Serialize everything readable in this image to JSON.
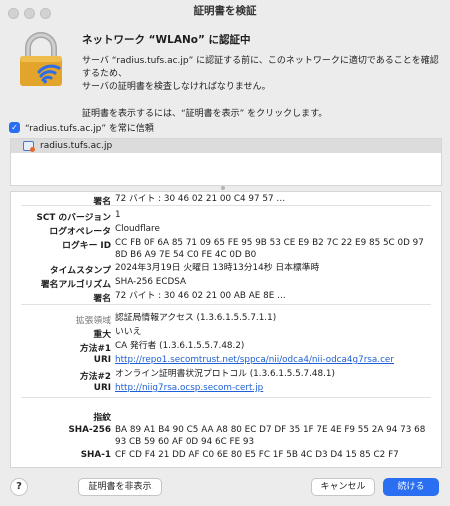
{
  "window": {
    "title": "証明書を検証"
  },
  "header": {
    "title": "ネットワーク “WLANo” に認証中",
    "desc1": "サーバ “radius.tufs.ac.jp” に認証する前に、このネットワークに適切であることを確認するため、",
    "desc2": "サーバの証明書を検査しなければなりません。",
    "note": "証明書を表示するには、“証明書を表示” をクリックします。"
  },
  "trust": {
    "label": "“radius.tufs.ac.jp” を常に信頼",
    "checked": true
  },
  "cert_list": {
    "selected": "radius.tufs.ac.jp"
  },
  "details": {
    "rows": [
      {
        "key": "署名",
        "value": "72 バイト : 30 46 02 21 00 C4 97 57 …"
      },
      {
        "key": "SCT のバージョン",
        "value": "1"
      },
      {
        "key": "ログオペレータ",
        "value": "Cloudflare"
      },
      {
        "key": "ログキー ID",
        "value": "CC FB 0F 6A 85 71 09 65 FE 95 9B 53 CE E9 B2 7C 22 E9 85 5C 0D 97 8D B6 A9 7E 54 C0 FE 4C 0D B0"
      },
      {
        "key": "タイムスタンプ",
        "value": "2024年3月19日 火曜日 13時13分14秒 日本標準時"
      },
      {
        "key": "署名アルゴリズム",
        "value": "SHA-256 ECDSA"
      },
      {
        "key": "署名",
        "value": "72 バイト : 30 46 02 21 00 AB AE 8E …"
      },
      {
        "key": "拡張領域",
        "value": "認証局情報アクセス (1.3.6.1.5.5.7.1.1)"
      },
      {
        "key": "重大",
        "value": "いいえ"
      },
      {
        "key": "方法#1",
        "value": "CA 発行者 (1.3.6.1.5.5.7.48.2)"
      },
      {
        "key": "URI",
        "value": "http://repo1.secomtrust.net/sppca/nii/odca4/nii-odca4g7rsa.cer"
      },
      {
        "key": "方法#2",
        "value": "オンライン証明書状況プロトコル (1.3.6.1.5.5.7.48.1)"
      },
      {
        "key": "URI",
        "value": "http://niig7rsa.ocsp.secom-cert.jp"
      },
      {
        "key": "指紋",
        "value": ""
      },
      {
        "key": "SHA-256",
        "value": "BA 89 A1 B4 90 C5 AA A8 80 EC D7 DF 35 1F 7E 4E F9 55 2A 94 73 68 93 CB 59 60 AF 0D 94 6C FE 93"
      },
      {
        "key": "SHA-1",
        "value": "CF CD F4 21 DD AF C0 6E 80 E5 FC 1F 5B 4C D3 D4 15 85 C2 F7"
      }
    ]
  },
  "buttons": {
    "help": "?",
    "hide_cert": "証明書を非表示",
    "cancel": "キャンセル",
    "continue": "続ける"
  },
  "colors": {
    "accent": "#2a6ff2",
    "link": "#1d5fd6"
  }
}
